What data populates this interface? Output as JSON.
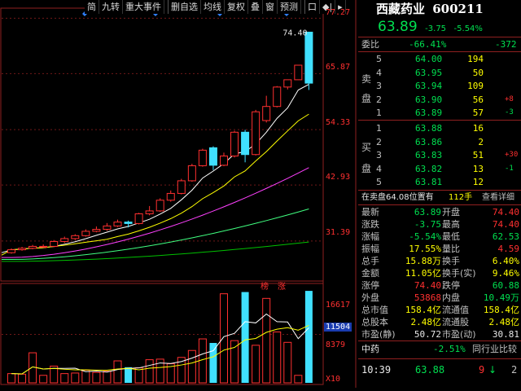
{
  "toolbar": {
    "items": [
      "简",
      "九转",
      "重大事件",
      "",
      "删自选",
      "均线",
      "复权",
      "叠",
      "窗",
      "预测",
      "",
      "口",
      "◆|",
      "▸"
    ]
  },
  "stock": {
    "name": "西藏药业",
    "code": "600211",
    "price": "63.89",
    "change": "-3.75",
    "change_pct": "-5.54%"
  },
  "price_axis": [
    "77.27",
    "65.87",
    "54.33",
    "42.93",
    "31.39"
  ],
  "volume_axis": [
    "16617",
    "11504",
    "8379",
    "X10"
  ],
  "chart_labels": {
    "peak": "74.40",
    "badge1": "榜",
    "badge2": "涨"
  },
  "weibi": {
    "label": "委比",
    "pct": "-66.41%",
    "diff": "-372"
  },
  "sell_label": [
    "卖",
    "盘"
  ],
  "buy_label": [
    "买",
    "盘"
  ],
  "sell_orders": [
    {
      "n": "5",
      "price": "64.00",
      "vol": "194",
      "chg": ""
    },
    {
      "n": "4",
      "price": "63.95",
      "vol": "50",
      "chg": ""
    },
    {
      "n": "3",
      "price": "63.94",
      "vol": "109",
      "chg": ""
    },
    {
      "n": "2",
      "price": "63.90",
      "vol": "56",
      "chg": "+8"
    },
    {
      "n": "1",
      "price": "63.89",
      "vol": "57",
      "chg": "-3"
    }
  ],
  "buy_orders": [
    {
      "n": "1",
      "price": "63.88",
      "vol": "16",
      "chg": ""
    },
    {
      "n": "2",
      "price": "63.86",
      "vol": "2",
      "chg": ""
    },
    {
      "n": "3",
      "price": "63.83",
      "vol": "51",
      "chg": "+30"
    },
    {
      "n": "4",
      "price": "63.82",
      "vol": "13",
      "chg": "-1"
    },
    {
      "n": "5",
      "price": "63.81",
      "vol": "12",
      "chg": ""
    }
  ],
  "info_bar": {
    "text": "在卖盘64.08位置有",
    "vol": "112手",
    "link": "查看详细"
  },
  "stats": [
    {
      "l1": "最新",
      "v1": "63.89",
      "c1": "green",
      "l2": "开盘",
      "v2": "74.40",
      "c2": "red"
    },
    {
      "l1": "涨跌",
      "v1": "-3.75",
      "c1": "green",
      "l2": "最高",
      "v2": "74.40",
      "c2": "red"
    },
    {
      "l1": "涨幅",
      "v1": "-5.54%",
      "c1": "green",
      "l2": "最低",
      "v2": "62.53",
      "c2": "green"
    },
    {
      "l1": "振幅",
      "v1": "17.55%",
      "c1": "yellow",
      "l2": "量比",
      "v2": "4.59",
      "c2": "red"
    },
    {
      "l1": "总手",
      "v1": "15.88万",
      "c1": "yellow",
      "l2": "换手",
      "v2": "6.40%",
      "c2": "yellow"
    },
    {
      "l1": "金额",
      "v1": "11.05亿",
      "c1": "yellow",
      "l2": "换手(实)",
      "v2": "9.46%",
      "c2": "yellow"
    },
    {
      "l1": "涨停",
      "v1": "74.40",
      "c1": "red",
      "l2": "跌停",
      "v2": "60.88",
      "c2": "green"
    },
    {
      "l1": "外盘",
      "v1": "53868",
      "c1": "red",
      "l2": "内盘",
      "v2": "10.49万",
      "c2": "green"
    },
    {
      "l1": "总市值",
      "v1": "158.4亿",
      "c1": "yellow",
      "l2": "流通值",
      "v2": "158.4亿",
      "c2": "yellow"
    },
    {
      "l1": "总股本",
      "v1": "2.48亿",
      "c1": "yellow",
      "l2": "流通股",
      "v2": "2.48亿",
      "c2": "yellow"
    },
    {
      "l1": "市盈(静)",
      "v1": "50.72",
      "c1": "white",
      "l2": "市盈(动)",
      "v2": "30.81",
      "c2": "white"
    }
  ],
  "sector": {
    "name": "中药",
    "pct": "-2.51%",
    "link": "同行业比较"
  },
  "tick": {
    "time": "10:39",
    "price": "63.88",
    "vol": "9",
    "dir": "↓",
    "extra": "2"
  },
  "colors": {
    "up": "#ff3030",
    "down": "#40e0ff",
    "ma5": "#ffffff",
    "ma10": "#ffff00",
    "ma20": "#ff40ff",
    "ma30": "#40ff80",
    "ma60": "#00c000"
  },
  "chart_data": {
    "type": "candlestick",
    "candles": [
      {
        "o": 29.0,
        "c": 29.6,
        "h": 29.9,
        "l": 28.8
      },
      {
        "o": 29.6,
        "c": 29.9,
        "h": 30.2,
        "l": 29.4
      },
      {
        "o": 29.9,
        "c": 30.3,
        "h": 30.6,
        "l": 29.7
      },
      {
        "o": 30.3,
        "c": 30.3,
        "h": 30.7,
        "l": 30.0
      },
      {
        "o": 30.3,
        "c": 31.3,
        "h": 31.6,
        "l": 30.1
      },
      {
        "o": 31.3,
        "c": 31.9,
        "h": 32.3,
        "l": 31.0
      },
      {
        "o": 31.9,
        "c": 32.5,
        "h": 32.8,
        "l": 31.6
      },
      {
        "o": 32.5,
        "c": 33.4,
        "h": 33.8,
        "l": 32.3
      },
      {
        "o": 33.4,
        "c": 33.8,
        "h": 34.4,
        "l": 33.2
      },
      {
        "o": 33.8,
        "c": 34.5,
        "h": 35.1,
        "l": 33.5
      },
      {
        "o": 34.5,
        "c": 35.3,
        "h": 35.8,
        "l": 34.3
      },
      {
        "o": 35.3,
        "c": 35.0,
        "h": 35.6,
        "l": 34.2
      },
      {
        "o": 35.0,
        "c": 37.0,
        "h": 37.2,
        "l": 34.8
      },
      {
        "o": 37.0,
        "c": 37.6,
        "h": 38.6,
        "l": 36.7
      },
      {
        "o": 37.6,
        "c": 39.8,
        "h": 40.2,
        "l": 37.4
      },
      {
        "o": 39.8,
        "c": 41.2,
        "h": 41.8,
        "l": 39.5
      },
      {
        "o": 41.2,
        "c": 43.8,
        "h": 44.2,
        "l": 41.0
      },
      {
        "o": 43.8,
        "c": 46.9,
        "h": 47.3,
        "l": 43.6
      },
      {
        "o": 46.9,
        "c": 50.1,
        "h": 50.4,
        "l": 46.7
      },
      {
        "o": 50.6,
        "c": 47.0,
        "h": 50.9,
        "l": 46.0
      },
      {
        "o": 47.0,
        "c": 48.9,
        "h": 49.6,
        "l": 46.8
      },
      {
        "o": 48.9,
        "c": 53.8,
        "h": 54.1,
        "l": 48.6
      },
      {
        "o": 53.8,
        "c": 49.2,
        "h": 54.3,
        "l": 47.6
      },
      {
        "o": 49.2,
        "c": 58.0,
        "h": 58.4,
        "l": 49.0
      },
      {
        "o": 56.2,
        "c": 59.1,
        "h": 61.3,
        "l": 55.8
      },
      {
        "o": 59.1,
        "c": 63.1,
        "h": 63.3,
        "l": 58.9
      },
      {
        "o": 63.1,
        "c": 64.6,
        "h": 64.6,
        "l": 62.6
      },
      {
        "o": 64.6,
        "c": 67.6,
        "h": 67.6,
        "l": 64.6
      },
      {
        "o": 74.4,
        "c": 63.9,
        "h": 74.4,
        "l": 62.5
      }
    ],
    "volumes": [
      1600,
      1500,
      5200,
      1300,
      2900,
      1600,
      1700,
      2200,
      1800,
      2000,
      3800,
      2700,
      2600,
      4000,
      4100,
      3300,
      4400,
      5600,
      7600,
      6900,
      15400,
      7300,
      15700,
      6500,
      14600,
      8800,
      7000,
      1300,
      15900
    ],
    "ylim": [
      24.0,
      78.0
    ],
    "vol_ylim": [
      0,
      16617
    ]
  }
}
